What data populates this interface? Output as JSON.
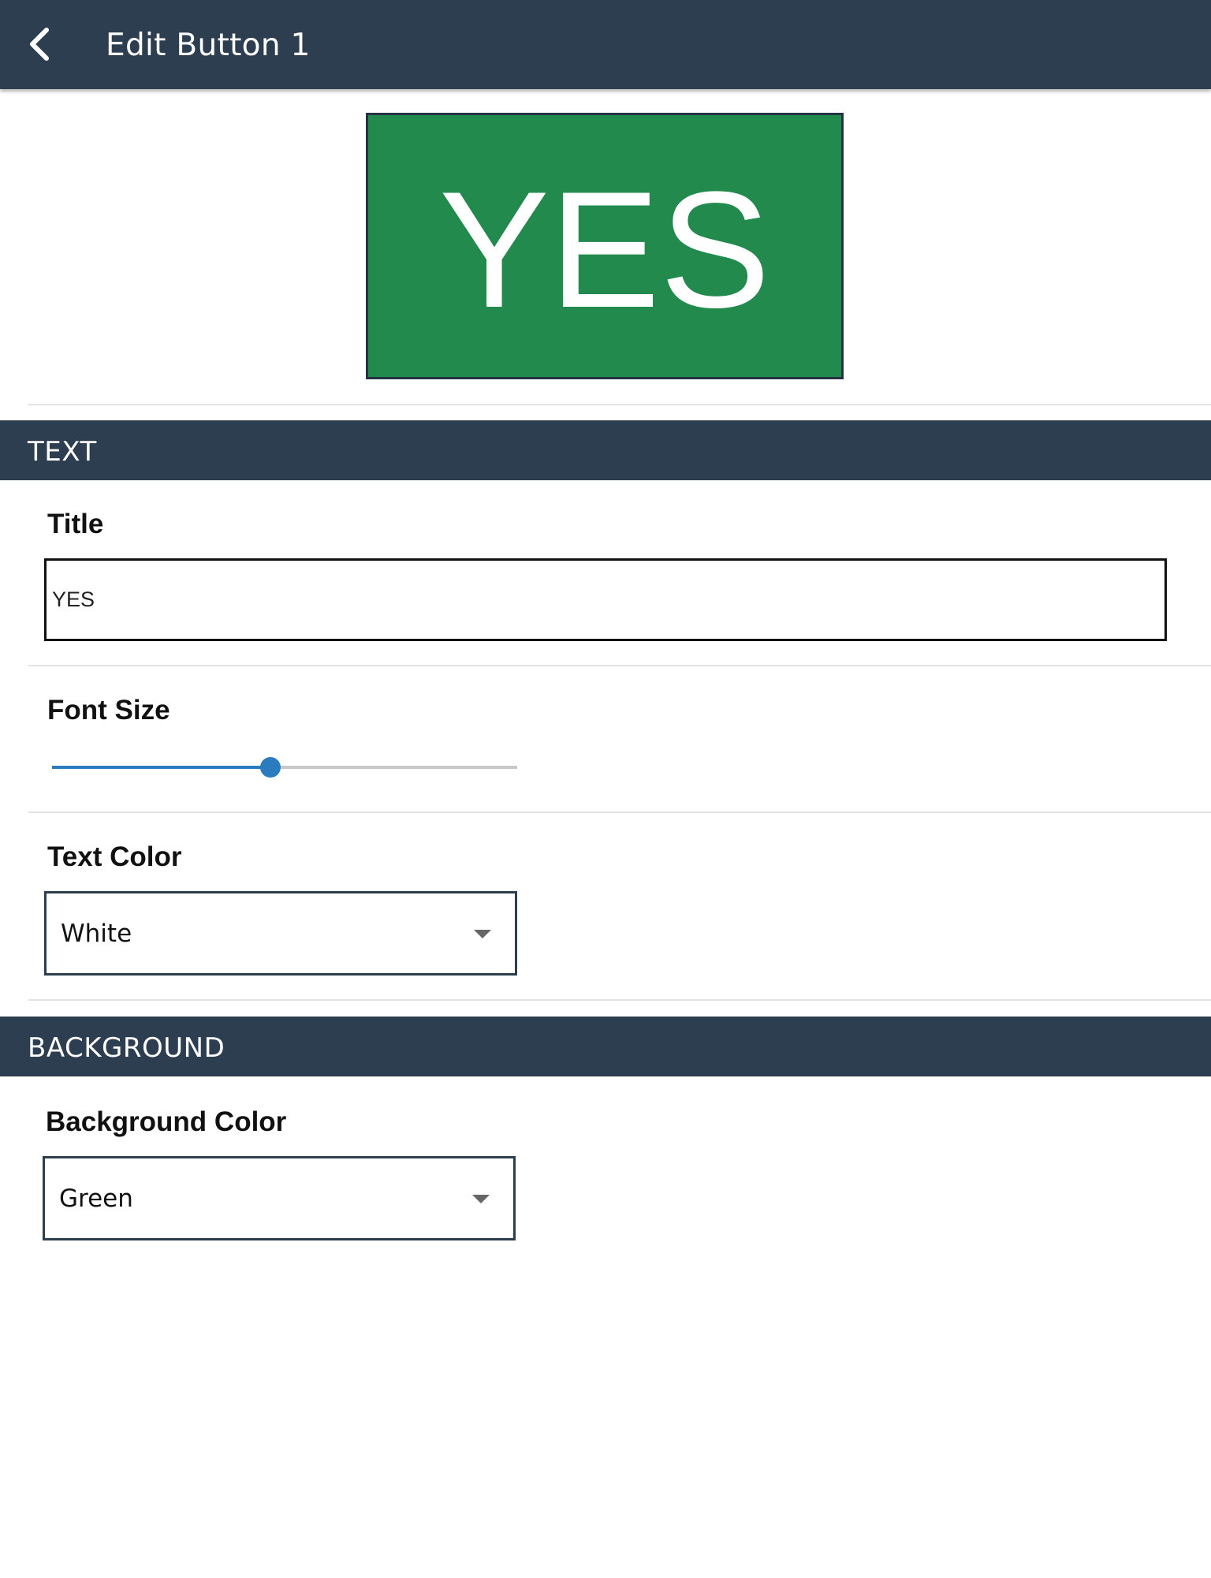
{
  "app_bar": {
    "title": "Edit Button 1",
    "back_icon": "chevron-left-icon"
  },
  "preview": {
    "label": "YES",
    "background_color": "#218a4c",
    "text_color": "#ffffff"
  },
  "text_section": {
    "header": "TEXT",
    "title_label": "Title",
    "title_value": "YES",
    "font_size_label": "Font Size",
    "font_size_level": 0.47,
    "text_color_label": "Text Color",
    "text_color_value": "White"
  },
  "background_section": {
    "header": "BACKGROUND",
    "background_color_label": "Background Color",
    "background_color_value": "Green"
  },
  "theme": {
    "header_color": "#2d3e50",
    "accent_color": "#2b7bbf"
  }
}
